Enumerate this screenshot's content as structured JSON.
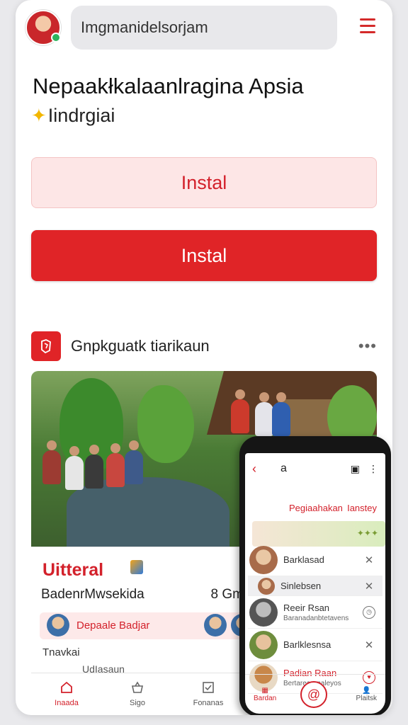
{
  "header": {
    "search_value": "Imgmanidelsorjam"
  },
  "hero": {
    "title": "Nepaakłkalaanlragina Apsia",
    "subtitle": "Iindrgiai",
    "install_light_label": "Instal",
    "install_solid_label": "Instal"
  },
  "section": {
    "label": "Gnpkguatk tiarikaun",
    "more": "•••"
  },
  "info_card": {
    "brand": "Uitteral",
    "row_left": "BadenrMwsekida",
    "row_right": "8 Gm",
    "chip_text": "Depaale Badjar",
    "sub1": "Tnavkai",
    "sub2": "UdIasaun"
  },
  "nav": [
    {
      "label": "Inaada"
    },
    {
      "label": "Sigo"
    },
    {
      "label": "Fonanas"
    }
  ],
  "phone": {
    "top_a": "a",
    "tab1": "Pegiaahakan",
    "tab2": "Ianstey",
    "banner_stars": "✦✦✦",
    "rows": [
      {
        "title": "Barklasad",
        "subtitle": ""
      },
      {
        "title": "Sinlebsen",
        "subtitle": ""
      },
      {
        "title": "Reeir Rsan",
        "subtitle": "Baranadanbtetavens"
      },
      {
        "title": "Barlklesnsa",
        "subtitle": ""
      },
      {
        "title": "Padian Raan",
        "subtitle": "Bertarearanaleyos"
      }
    ],
    "nav": [
      {
        "label": "Bardan"
      },
      {
        "label": "Plaitsk"
      }
    ]
  },
  "colors": {
    "accent": "#e02427",
    "accent_light": "#fde6e6",
    "text": "#1d1d1f"
  }
}
